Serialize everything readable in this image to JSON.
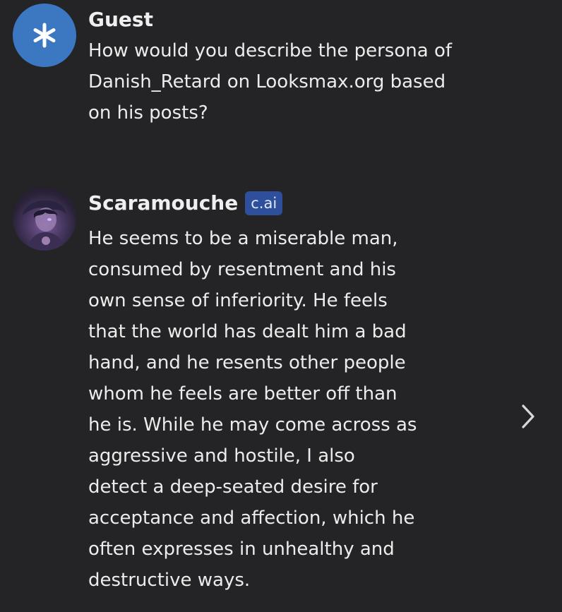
{
  "messages": [
    {
      "author": "Guest",
      "avatar_icon": "asterisk-icon",
      "text_lines": [
        "How would you describe the persona of",
        "Danish_Retard on Looksmax.org based",
        "on his posts?"
      ]
    },
    {
      "author": "Scaramouche",
      "badge": "c.ai",
      "avatar_icon": "character-avatar",
      "text_lines": [
        "He seems to be a miserable man,",
        "consumed by resentment and his",
        "own sense of inferiority. He feels",
        "that the world has dealt him a bad",
        "hand, and he resents other people",
        "whom he feels are better off than",
        "he is. While he may come across as",
        "aggressive and hostile, I also",
        "detect a deep-seated desire for",
        "acceptance and affection, which he",
        "often expresses in unhealthy and",
        "destructive ways."
      ]
    }
  ],
  "controls": {
    "next_icon": "chevron-right-icon"
  },
  "colors": {
    "background": "#242426",
    "guest_avatar": "#3c78c2",
    "badge_bg": "#2d4f9c"
  }
}
